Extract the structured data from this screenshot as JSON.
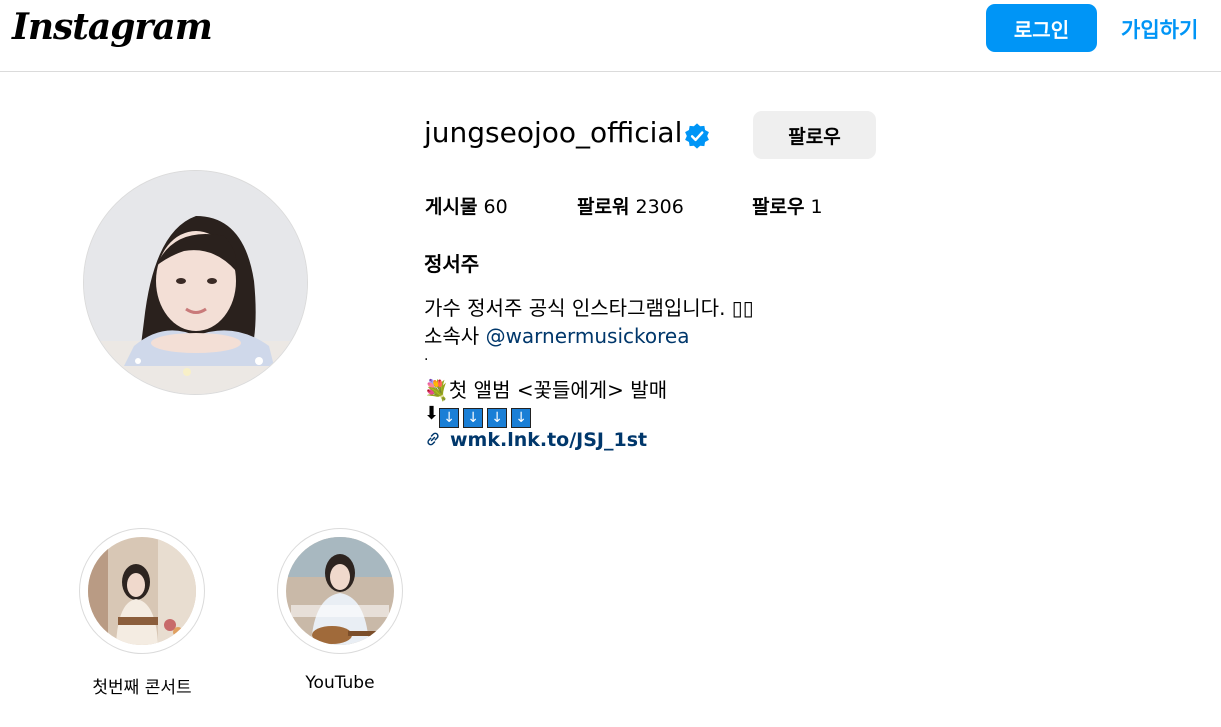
{
  "header": {
    "logo": "Instagram",
    "login_label": "로그인",
    "signup_label": "가입하기"
  },
  "profile": {
    "username": "jungseojoo_official",
    "follow_label": "팔로우",
    "stats": {
      "posts_label": "게시물",
      "posts_value": "60",
      "followers_label": "팔로워",
      "followers_value": "2306",
      "following_label": "팔로우",
      "following_value": "1"
    },
    "full_name": "정서주",
    "bio": {
      "line1": "가수 정서주 공식 인스타그램입니다. ▯▯",
      "line2_prefix": "소속사 ",
      "line2_mention": "@warnermusickorea",
      "line3": ".",
      "line4_emoji": "💐",
      "line4_text": "첫 앨범 <꽃들에게> 발매",
      "line5_arrow": "⬇",
      "line5_boxes": [
        "↓",
        "↓",
        "↓",
        "↓"
      ]
    },
    "link": {
      "icon": "link-icon",
      "text": "wmk.lnk.to/JSJ_1st"
    }
  },
  "highlights": [
    {
      "label": "첫번째 콘서트"
    },
    {
      "label": "YouTube"
    }
  ],
  "colors": {
    "accent": "#0095f6",
    "link": "#00376b",
    "verified": "#0095f6",
    "button_gray": "#efefef"
  }
}
